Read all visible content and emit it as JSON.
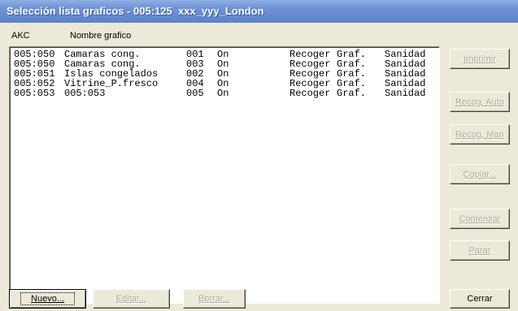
{
  "window": {
    "title": "Selección lista graficos - 005:125  xxx_yyy_London"
  },
  "columns": {
    "akc": "AKC",
    "nombre": "Nombre grafico"
  },
  "rows": [
    {
      "akc": "005:050",
      "nombre": "Camaras cong.",
      "num": "001",
      "estado": "On",
      "accion": "Recoger",
      "tipo": "Graf.",
      "categoria": "Sanidad"
    },
    {
      "akc": "005:050",
      "nombre": "Camaras cong.",
      "num": "003",
      "estado": "On",
      "accion": "Recoger",
      "tipo": "Graf.",
      "categoria": "Sanidad"
    },
    {
      "akc": "005:051",
      "nombre": "Islas congelados",
      "num": "002",
      "estado": "On",
      "accion": "Recoger",
      "tipo": "Graf.",
      "categoria": "Sanidad"
    },
    {
      "akc": "005:052",
      "nombre": "Vitrine_P.fresco",
      "num": "004",
      "estado": "On",
      "accion": "Recoger",
      "tipo": "Graf.",
      "categoria": "Sanidad"
    },
    {
      "akc": "005:053",
      "nombre": "005:053",
      "num": "005",
      "estado": "On",
      "accion": "Recoger",
      "tipo": "Graf.",
      "categoria": "Sanidad"
    }
  ],
  "buttons": {
    "imprimir": "Imprimir",
    "recog_auto": "Recog. Auto",
    "recog_man": "Recog. Man",
    "copiar": "Copiar...",
    "comenzar": "Comenzar",
    "parar": "Parar",
    "nuevo": "Nuevo...",
    "editar": "Editar...",
    "borrar": "Borrar...",
    "cerrar": "Cerrar"
  }
}
